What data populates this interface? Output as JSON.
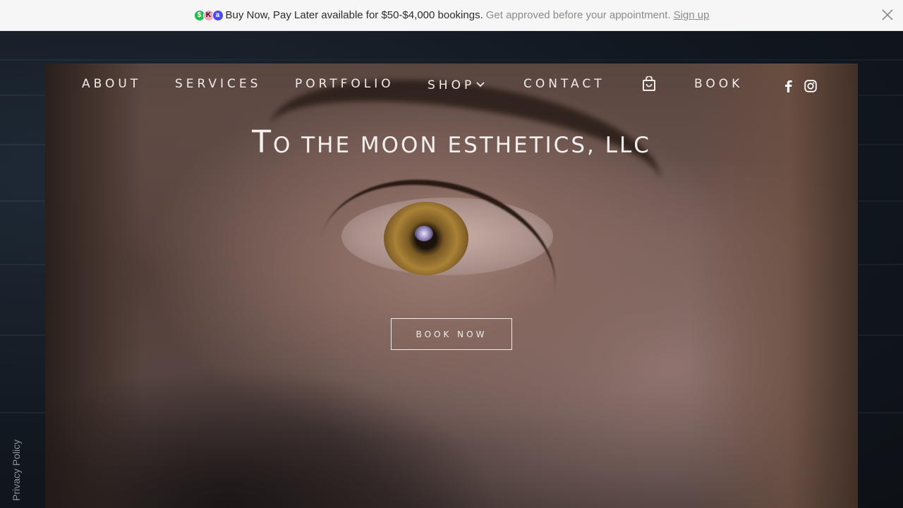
{
  "promo": {
    "logos": [
      {
        "icon": "cherry-logo-icon",
        "glyph": "$",
        "color": "#1fbf4a"
      },
      {
        "icon": "klarna-logo-icon",
        "glyph": "K",
        "color": "#f2a7c5"
      },
      {
        "icon": "affirm-logo-icon",
        "glyph": "a",
        "color": "#4a4cf0"
      }
    ],
    "main_text": "Buy Now, Pay Later available for $50-$4,000 bookings.",
    "sub_text": "Get approved before your appointment.",
    "link_text": "Sign up"
  },
  "nav": {
    "items": [
      {
        "label": "ABOUT"
      },
      {
        "label": "SERVICES"
      },
      {
        "label": "PORTFOLIO"
      },
      {
        "label": "SHOP"
      },
      {
        "label": "CONTACT"
      },
      {
        "label": "BOOK"
      }
    ],
    "cart_icon": "shopping-bag-icon",
    "social": [
      "facebook-icon",
      "instagram-icon"
    ]
  },
  "hero": {
    "title_first": "T",
    "title_rest": "O THE MOON ESTHETICS, LLC",
    "cta_label": "BOOK NOW"
  },
  "footer": {
    "privacy_label": "Privacy Policy"
  },
  "colors": {
    "promo_bg": "#f6f6f6",
    "nav_text": "#f1ece9",
    "page_bg": "#16181c"
  }
}
